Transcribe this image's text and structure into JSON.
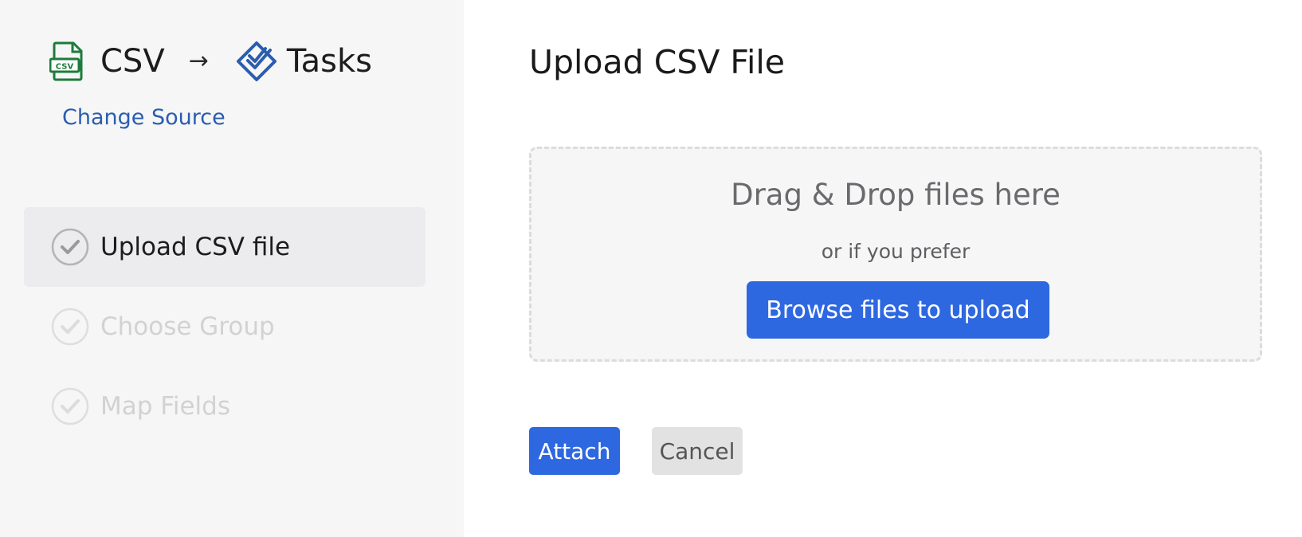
{
  "sidebar": {
    "source": {
      "icon": "csv-file-icon",
      "icon_text": "CSV",
      "label": "CSV",
      "color": "#1e7b3c"
    },
    "arrow": "→",
    "destination": {
      "icon": "tasks-icon",
      "label": "Tasks",
      "color": "#2a5db0"
    },
    "change_source_label": "Change Source",
    "steps": [
      {
        "label": "Upload CSV file",
        "state": "active"
      },
      {
        "label": "Choose Group",
        "state": "inactive"
      },
      {
        "label": "Map Fields",
        "state": "inactive"
      }
    ]
  },
  "main": {
    "title": "Upload CSV File",
    "dropzone": {
      "heading": "Drag & Drop files here",
      "subtext": "or if you prefer",
      "browse_label": "Browse files to upload"
    },
    "actions": {
      "attach_label": "Attach",
      "cancel_label": "Cancel"
    }
  },
  "colors": {
    "accent": "#2e68e0",
    "sidebar_bg": "#f6f6f6",
    "active_step_bg": "#ececee",
    "link": "#2a5db0"
  }
}
